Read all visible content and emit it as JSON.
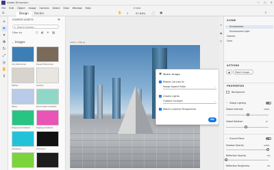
{
  "app": {
    "title": "Adobe Dimension",
    "doc_name": "0 test"
  },
  "window": {
    "minimize": "—",
    "maximize": "☐",
    "close": "✕"
  },
  "menu": [
    "File",
    "Edit",
    "Object",
    "Image",
    "Camera",
    "Select",
    "View",
    "Window",
    "Help"
  ],
  "tabs": {
    "design": "Design",
    "render": "Render"
  },
  "toolbar": {
    "zoom": "97.66%"
  },
  "assets": {
    "header": "STARTER ASSETS",
    "search_placeholder": "Search Assets...",
    "filter_label": "Filter by",
    "section": "Images",
    "items": [
      {
        "label": "City Backdrop",
        "color": "#3d7fb4"
      },
      {
        "label": "Desert Backdrop",
        "color": "#7a6a5a"
      },
      {
        "label": "Tables",
        "color": "#d9d3cd"
      },
      {
        "label": "Gallery",
        "color": "#e9e5e1"
      },
      {
        "label": "Table",
        "color": "#b8cbe8"
      },
      {
        "label": "Horizontal Gradient",
        "color": "#8fd8c8"
      },
      {
        "label": "Diagonal Gradient",
        "color": "#27c483"
      },
      {
        "label": "Zigzag Gradient",
        "color": "#e855b5"
      },
      {
        "label": "Checkers",
        "color": "#22c3d8"
      },
      {
        "label": "Checkers",
        "color": "#111111"
      },
      {
        "label": "",
        "color": "#7bd43a"
      },
      {
        "label": "",
        "color": "#1d1d1d"
      }
    ]
  },
  "canvas": {
    "label": "1024 × 768 px"
  },
  "dialog": {
    "title": "Match Image",
    "resize_label": "Resize Canvas to",
    "resize_value": "Image Aspect Ratio",
    "lighting_label": "Create Lights",
    "lighting_value": "Outdoor Sunlight",
    "perspective_label": "Match Camera Perspective",
    "ok": "OK"
  },
  "right": {
    "scene_header": "SCENE",
    "scene_items": [
      "Environment",
      "Environment Light",
      "Camera",
      "Cone"
    ],
    "actions_header": "ACTIONS",
    "match_image_btn": "Match Image...",
    "properties_header": "PROPERTIES",
    "background": "Background",
    "global_lighting": "Global Lighting",
    "global_intensity": "Global Intensity",
    "global_intensity_value": "100%",
    "global_rotation": "Global Rotation",
    "global_rotation_value": "0°",
    "ground_plane": "Ground Plane",
    "shadow_opacity": "Shadow Opacity",
    "shadow_opacity_value": "100%",
    "reflection_opacity": "Reflection Opacity",
    "reflection_opacity_value": "0%",
    "reflection_roughness": "Reflection Roughness",
    "reflection_roughness_value": "0%"
  },
  "colors": {
    "accent": "#1473e6"
  }
}
